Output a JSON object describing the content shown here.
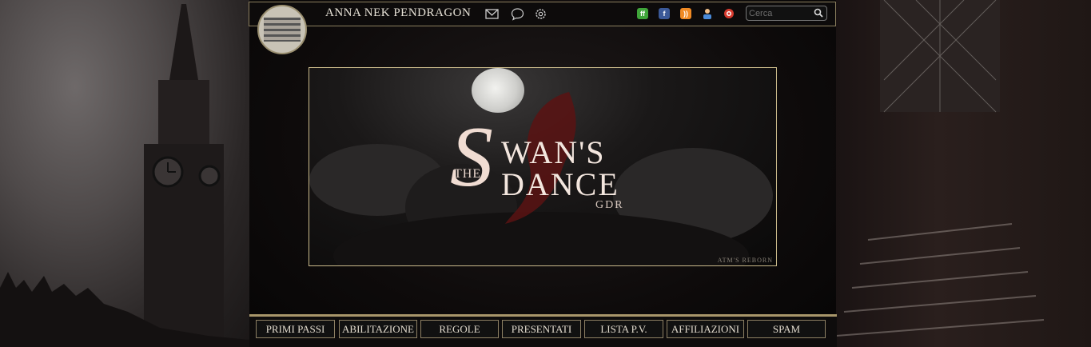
{
  "header": {
    "username": "ANNA NEK PENDRAGON",
    "icons": [
      "mail-icon",
      "chat-icon",
      "gear-icon"
    ],
    "social": [
      "forumfree-icon",
      "facebook-icon",
      "rss-icon",
      "user-online-icon",
      "help-icon"
    ],
    "search_placeholder": "Cerca"
  },
  "banner": {
    "title_s": "S",
    "title_wan": "WAN'S",
    "title_the": "THE",
    "title_dance": "DANCE",
    "title_gdr": "GDR",
    "credit": "ATM'S REBORN"
  },
  "nav": {
    "items": [
      {
        "label": "PRIMI PASSI"
      },
      {
        "label": "ABILITAZIONE"
      },
      {
        "label": "REGOLE"
      },
      {
        "label": "PRESENTATI"
      },
      {
        "label": "LISTA P.V."
      },
      {
        "label": "AFFILIAZIONI"
      },
      {
        "label": "SPAM"
      }
    ]
  },
  "colors": {
    "accent_gold": "#a8966a",
    "text_light": "#e3dccf"
  }
}
